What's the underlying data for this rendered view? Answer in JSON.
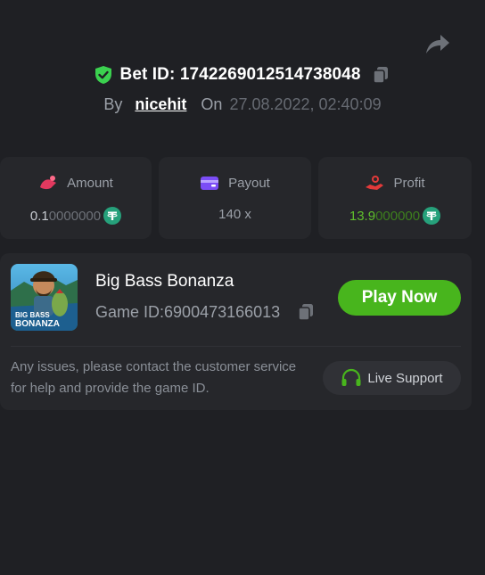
{
  "bet": {
    "label_prefix": "Bet ID: ",
    "id": "1742269012514738048",
    "by_label": "By",
    "user": "nicehit",
    "on_label": "On",
    "date": "27.08.2022, 02:40:09"
  },
  "stats": {
    "amount": {
      "label": "Amount",
      "value_main": "0.1",
      "value_tail": "0000000"
    },
    "payout": {
      "label": "Payout",
      "value": "140 x"
    },
    "profit": {
      "label": "Profit",
      "value_main": "13.9",
      "value_tail": "000000"
    }
  },
  "game": {
    "name": "Big Bass Bonanza",
    "id_label": "Game ID: ",
    "id": "6900473166013",
    "thumb_text_1": "BIG BASS",
    "thumb_text_2": "BONANZA",
    "play_label": "Play Now"
  },
  "support": {
    "message": "Any issues, please contact the customer service for help and provide the game ID.",
    "button_label": "Live Support"
  },
  "colors": {
    "background": "#1f2024",
    "card": "#26272b",
    "accent_green": "#48b51d",
    "profit_green": "#5fbf2c",
    "coin_teal": "#26a17b",
    "shield_green": "#3bd14f"
  },
  "icons": [
    "share-icon",
    "shield-check-icon",
    "copy-icon",
    "amount-icon",
    "wallet-icon",
    "profit-icon",
    "tether-coin-icon",
    "headset-icon"
  ]
}
